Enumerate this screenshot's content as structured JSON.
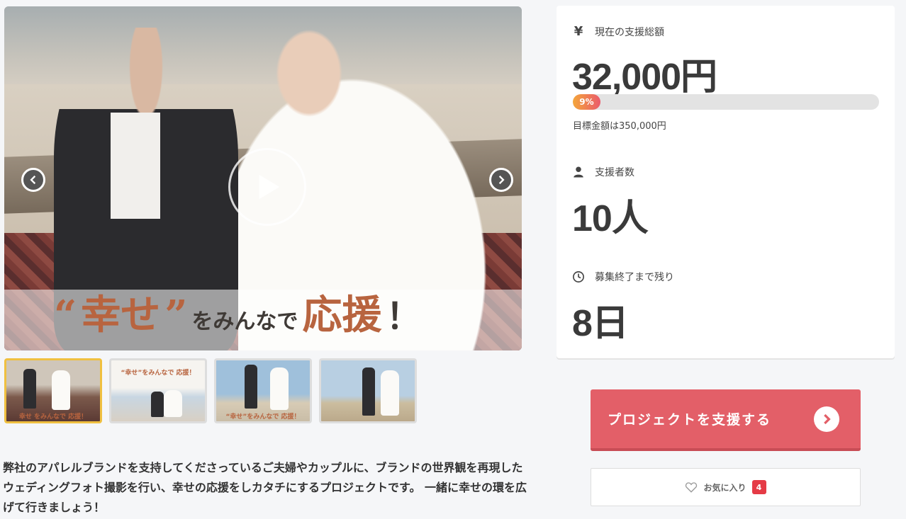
{
  "hero": {
    "caption_quote_open": "“",
    "caption_keyword": "幸せ",
    "caption_quote_close": "”",
    "caption_middle": "をみんなで",
    "caption_highlight": "応援",
    "caption_end": "！"
  },
  "thumbnails": [
    {
      "caption": "幸せ をみんなで 応援！",
      "active": true
    },
    {
      "caption": "“幸せ”をみんなで 応援！",
      "active": false
    },
    {
      "caption": "“幸せ”をみんなで 応援！",
      "active": false
    },
    {
      "caption": "",
      "active": false
    }
  ],
  "description": "弊社のアパレルブランドを支持してくださっているご夫婦やカップルに、ブランドの世界観を再現したウェディングフォト撮影を行い、幸せの応援をしカタチにするプロジェクトです。 一緒に幸せの環を広げて行きましょう！",
  "stats": {
    "amount_label": "現在の支援総額",
    "amount_icon": "yen-icon",
    "amount_icon_glyph": "¥",
    "amount_value": "32,000円",
    "progress_percent": 9,
    "progress_label": "9%",
    "goal_text": "目標金額は350,000円",
    "backers_label": "支援者数",
    "backers_value": "10人",
    "remaining_label": "募集終了まで残り",
    "remaining_value": "8日"
  },
  "actions": {
    "support_label": "プロジェクトを支援する",
    "favorite_label": "お気に入り",
    "favorite_count": "4"
  },
  "colors": {
    "accent": "#e35f68",
    "progress_start": "#f4a63a",
    "progress_end": "#ea5a6b",
    "badge": "#e53b46",
    "thumb_active": "#f0c040"
  }
}
